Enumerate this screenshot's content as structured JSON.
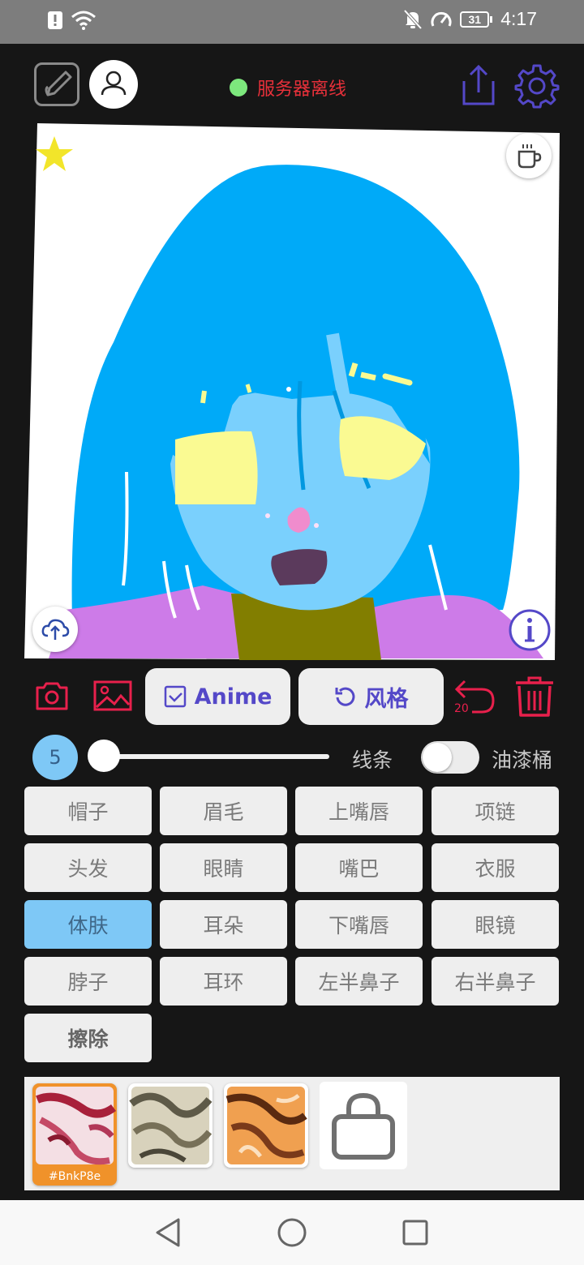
{
  "status_bar": {
    "time": "4:17",
    "battery": "31",
    "icons": [
      "alert-icon",
      "wifi-icon",
      "bell-off-icon",
      "speed-icon",
      "battery-icon"
    ]
  },
  "header": {
    "server_status": "服务器离线",
    "server_status_color": "#e8303a",
    "status_dot_color": "#7de87d",
    "icons": [
      "edit-icon",
      "user-icon",
      "share-icon",
      "settings-icon"
    ]
  },
  "canvas": {
    "icons": [
      "star-icon",
      "coffee-icon",
      "upload-icon",
      "info-icon"
    ]
  },
  "toolbar": {
    "anime_label": "Anime",
    "style_label": "风格",
    "undo_count": "20",
    "accent_color": "#e8204c",
    "pill_text_color": "#5448c8"
  },
  "brush": {
    "size": "5",
    "line_label": "线条",
    "bucket_label": "油漆桶",
    "bucket_enabled": false
  },
  "parts": [
    {
      "label": "帽子",
      "active": false
    },
    {
      "label": "眉毛",
      "active": false
    },
    {
      "label": "上嘴唇",
      "active": false
    },
    {
      "label": "项链",
      "active": false
    },
    {
      "label": "头发",
      "active": false
    },
    {
      "label": "眼睛",
      "active": false
    },
    {
      "label": "嘴巴",
      "active": false
    },
    {
      "label": "衣服",
      "active": false
    },
    {
      "label": "体肤",
      "active": true
    },
    {
      "label": "耳朵",
      "active": false
    },
    {
      "label": "下嘴唇",
      "active": false
    },
    {
      "label": "眼镜",
      "active": false
    },
    {
      "label": "脖子",
      "active": false
    },
    {
      "label": "耳环",
      "active": false
    },
    {
      "label": "左半鼻子",
      "active": false
    },
    {
      "label": "右半鼻子",
      "active": false
    },
    {
      "label": "擦除",
      "active": false
    }
  ],
  "palette": {
    "selected_code": "#BnkP8e",
    "icons": [
      "shopping-bag-icon"
    ]
  },
  "navigation": {
    "icons": [
      "back-icon",
      "home-icon",
      "recents-icon"
    ]
  }
}
